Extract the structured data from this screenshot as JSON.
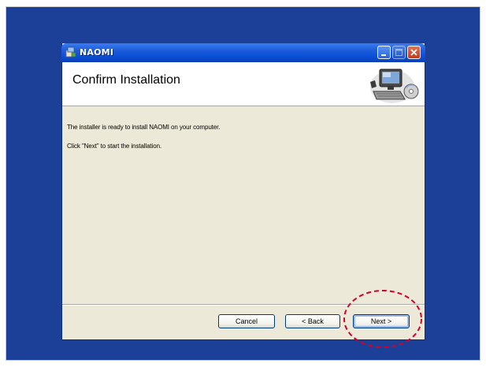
{
  "window": {
    "title": "NAOMI"
  },
  "header": {
    "title": "Confirm Installation",
    "graphic_icon": "computer-setup-icon"
  },
  "body": {
    "line1": "The installer is ready to install NAOMI on your computer.",
    "line2": "Click \"Next\" to start the installation."
  },
  "buttons": {
    "cancel": "Cancel",
    "back": "< Back",
    "next": "Next >"
  },
  "colors": {
    "desktop": "#1c3f98",
    "titlebar": "#0a4fd6",
    "dialog_bg": "#ece9d8",
    "highlight": "#d4002a"
  }
}
